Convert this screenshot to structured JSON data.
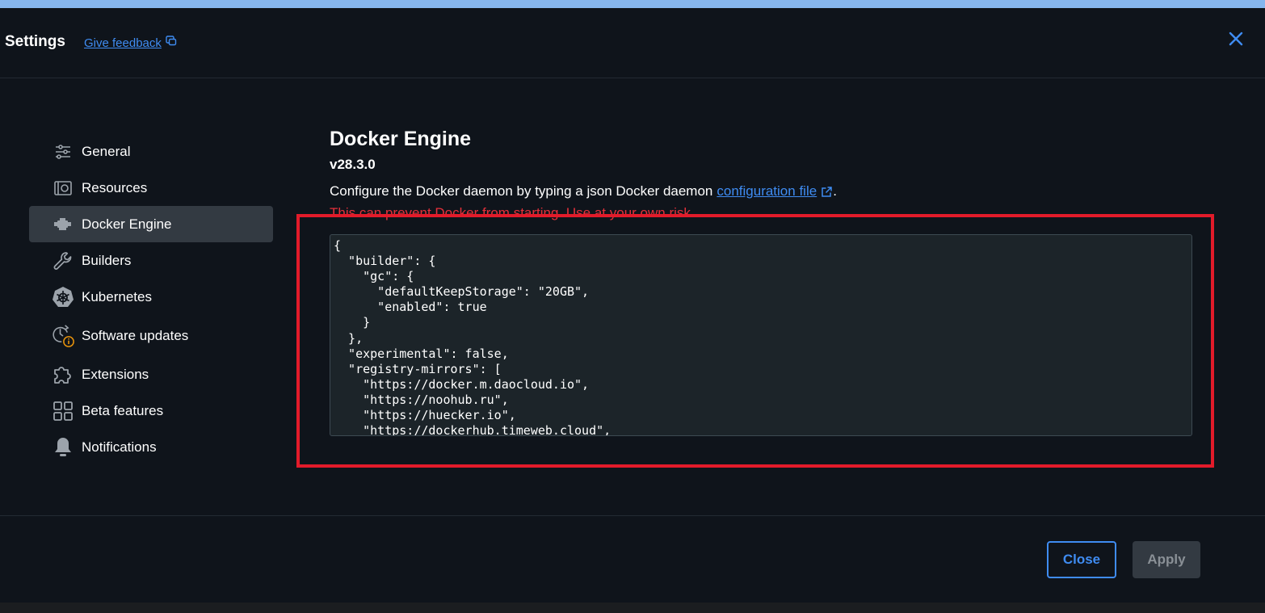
{
  "header": {
    "title": "Settings",
    "feedback_label": "Give feedback"
  },
  "sidebar": {
    "items": [
      {
        "label": "General",
        "icon": "sliders-icon"
      },
      {
        "label": "Resources",
        "icon": "resources-icon"
      },
      {
        "label": "Docker Engine",
        "icon": "engine-icon",
        "active": true
      },
      {
        "label": "Builders",
        "icon": "wrench-icon"
      },
      {
        "label": "Kubernetes",
        "icon": "kubernetes-icon"
      },
      {
        "label": "Software updates",
        "icon": "clock-update-icon"
      },
      {
        "label": "Extensions",
        "icon": "puzzle-icon"
      },
      {
        "label": "Beta features",
        "icon": "grid-icon"
      },
      {
        "label": "Notifications",
        "icon": "bell-icon"
      }
    ]
  },
  "main": {
    "title": "Docker Engine",
    "version": "v28.3.0",
    "description": "Configure the Docker daemon by typing a json Docker daemon",
    "config_link": "configuration file",
    "description_end": ".",
    "warning": "This can prevent Docker from starting. Use at your own risk.",
    "editor_content": "{\n  \"builder\": {\n    \"gc\": {\n      \"defaultKeepStorage\": \"20GB\",\n      \"enabled\": true\n    }\n  },\n  \"experimental\": false,\n  \"registry-mirrors\": [\n    \"https://docker.m.daocloud.io\",\n    \"https://noohub.ru\",\n    \"https://huecker.io\",\n    \"https://dockerhub.timeweb.cloud\","
  },
  "footer": {
    "close_label": "Close",
    "apply_label": "Apply"
  },
  "colors": {
    "accent": "#3f8cf2",
    "warning": "#e5303a",
    "highlight": "#e21b2a",
    "background": "#0f141b"
  }
}
